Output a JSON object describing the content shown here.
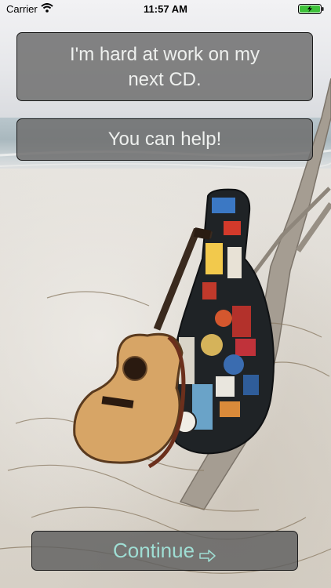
{
  "status_bar": {
    "carrier": "Carrier",
    "time": "11:57 AM"
  },
  "messages": [
    {
      "line1": "I'm hard at work on my",
      "line2": "next CD."
    },
    {
      "text": "You can help!"
    }
  ],
  "continue_button": {
    "label": "Continue"
  },
  "icons": [
    "wifi-icon",
    "battery-icon",
    "arrow-right-icon"
  ],
  "colors": {
    "box_fill": "#6e6e6e",
    "box_text": "#eef0ee",
    "continue_text": "#9fded4",
    "battery_green": "#3ec13a"
  }
}
